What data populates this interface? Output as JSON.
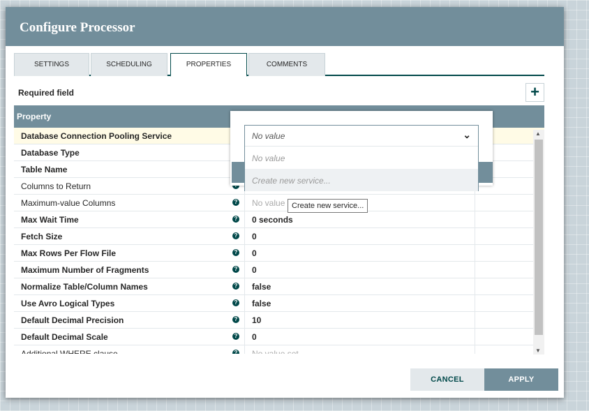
{
  "dialog": {
    "title": "Configure Processor"
  },
  "tabs": [
    {
      "label": "SETTINGS",
      "active": false
    },
    {
      "label": "SCHEDULING",
      "active": false
    },
    {
      "label": "PROPERTIES",
      "active": true
    },
    {
      "label": "COMMENTS",
      "active": false
    }
  ],
  "required_label": "Required field",
  "add_button": "+",
  "table": {
    "header": "Property",
    "help_glyph": "?",
    "rows": [
      {
        "name": "Database Connection Pooling Service",
        "value": "",
        "bold": true
      },
      {
        "name": "Database Type",
        "value": "",
        "bold": true
      },
      {
        "name": "Table Name",
        "value": "",
        "bold": true
      },
      {
        "name": "Columns to Return",
        "value": "",
        "bold": false
      },
      {
        "name": "Maximum-value Columns",
        "value": "No value",
        "bold": false
      },
      {
        "name": "Max Wait Time",
        "value": "0 seconds",
        "bold": true
      },
      {
        "name": "Fetch Size",
        "value": "0",
        "bold": true
      },
      {
        "name": "Max Rows Per Flow File",
        "value": "0",
        "bold": true
      },
      {
        "name": "Maximum Number of Fragments",
        "value": "0",
        "bold": true
      },
      {
        "name": "Normalize Table/Column Names",
        "value": "false",
        "bold": true
      },
      {
        "name": "Use Avro Logical Types",
        "value": "false",
        "bold": true
      },
      {
        "name": "Default Decimal Precision",
        "value": "10",
        "bold": true
      },
      {
        "name": "Default Decimal Scale",
        "value": "0",
        "bold": true
      },
      {
        "name": "Additional WHERE clause",
        "value": "No value set",
        "bold": false
      }
    ]
  },
  "dropdown": {
    "selected": "No value",
    "chevron": "⌄",
    "options": [
      "No value",
      "Create new service..."
    ]
  },
  "tooltip": "Create new service...",
  "buttons": {
    "cancel": "CANCEL",
    "apply": "APPLY"
  },
  "colors": {
    "header": "#728e9b",
    "accent": "#004849",
    "selected_row": "#fffbe6"
  }
}
